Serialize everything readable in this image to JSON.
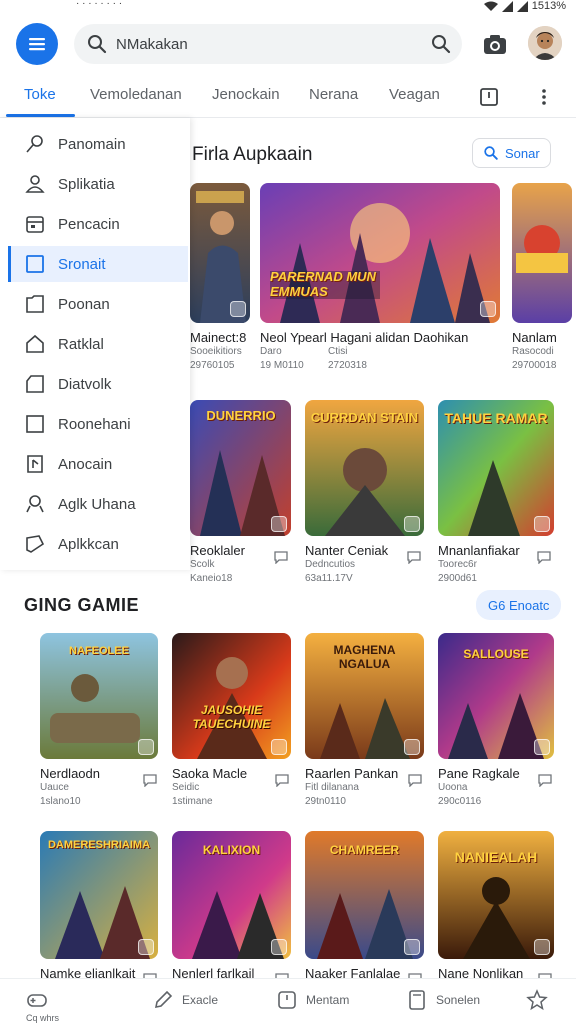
{
  "status_bar": {
    "battery": "1513%",
    "signal_icons": [
      "wifi-icon",
      "signal-icon",
      "signal-icon"
    ]
  },
  "search": {
    "value": "NMakakan",
    "icon": "search-icon"
  },
  "tabs": [
    {
      "label": "Toke",
      "active": true
    },
    {
      "label": "Vemoledanan",
      "active": false
    },
    {
      "label": "Jenockain",
      "active": false
    },
    {
      "label": "Nerana",
      "active": false
    },
    {
      "label": "Veagan",
      "active": false
    }
  ],
  "drawer": {
    "items": [
      {
        "label": "Panomain",
        "icon": "pin-icon"
      },
      {
        "label": "Splikatia",
        "icon": "person-icon"
      },
      {
        "label": "Pencacin",
        "icon": "calendar-icon"
      },
      {
        "label": "Sronait",
        "icon": "square-icon",
        "active": true
      },
      {
        "label": "Poonan",
        "icon": "folder-icon"
      },
      {
        "label": "Ratklal",
        "icon": "home-icon"
      },
      {
        "label": "Diatvolk",
        "icon": "shelf-icon"
      },
      {
        "label": "Roonehani",
        "icon": "box-icon"
      },
      {
        "label": "Anocain",
        "icon": "document-icon"
      },
      {
        "label": "Aglk Uhana",
        "icon": "user-icon"
      },
      {
        "label": "Aplkkcan",
        "icon": "tag-icon"
      }
    ]
  },
  "section1": {
    "title": "Firla Aupkaain",
    "button": "Sonar",
    "cards": [
      {
        "title": "Mainect:8",
        "sub1": "Sooeikitiors",
        "sub2": "29760105"
      },
      {
        "title": "Neol Ypearl Hagani alidan Daohikan",
        "sub1": "Daro",
        "sub2": "19 M0110",
        "sub3": "Ctisi",
        "sub4": "2720318",
        "art_text": "PARERNAD MUN EMMUAS"
      },
      {
        "title": "Nanlam",
        "sub1": "Rasocodi",
        "sub2": "29700018"
      }
    ],
    "row2": [
      {
        "title": "Reoklaler",
        "sub1": "Scolk",
        "sub2": "Kaneio18",
        "art_text": "DUNERRIO"
      },
      {
        "title": "Nanter Ceniak",
        "sub1": "Dedncutios",
        "sub2": "63a11.17V",
        "art_text": "CURRDAN STAIN"
      },
      {
        "title": "Mnanlanfiakar",
        "sub1": "Toorec6r",
        "sub2": "2900d61",
        "art_text": "TAHUE RAMAR"
      }
    ]
  },
  "section2": {
    "title": "GING GAMIE",
    "button": "G6 Enoatc",
    "cards": [
      {
        "title": "Nerdlaodn",
        "sub1": "Uauce",
        "sub2": "1slano10",
        "art_text": "NAFEOLEE"
      },
      {
        "title": "Saoka Macle",
        "sub1": "Seidic",
        "sub2": "1stimane",
        "art_text": "JAUSOHIE TAUECHUINE"
      },
      {
        "title": "Raarlen Pankan",
        "sub1": "Fitl dilanana",
        "sub2": "29tn0110",
        "art_text": "MAGHENA NGALUA"
      },
      {
        "title": "Pane Ragkale",
        "sub1": "Uoona",
        "sub2": "290c0116",
        "art_text": "SALLOUSE"
      },
      {
        "title": "Namke elianlkait",
        "art_text": "DAMERESHRIAIMA"
      },
      {
        "title": "Nenlerl farlkail",
        "art_text": "KALIXION"
      },
      {
        "title": "Naaker Fanlalae",
        "art_text": "CHAMREER"
      },
      {
        "title": "Nane Nonlikan",
        "art_text": "NANIEALAH"
      }
    ]
  },
  "bottom_nav": [
    {
      "label": "Cq whrs",
      "icon": "controller-icon"
    },
    {
      "label": "Exacle",
      "icon": "edit-icon"
    },
    {
      "label": "Mentam",
      "icon": "clock-icon"
    },
    {
      "label": "Sonelen",
      "icon": "tablet-icon"
    },
    {
      "label": "",
      "icon": "star-icon"
    }
  ],
  "colors": {
    "accent": "#1a73e8",
    "accent_light": "#e8f0fe"
  }
}
